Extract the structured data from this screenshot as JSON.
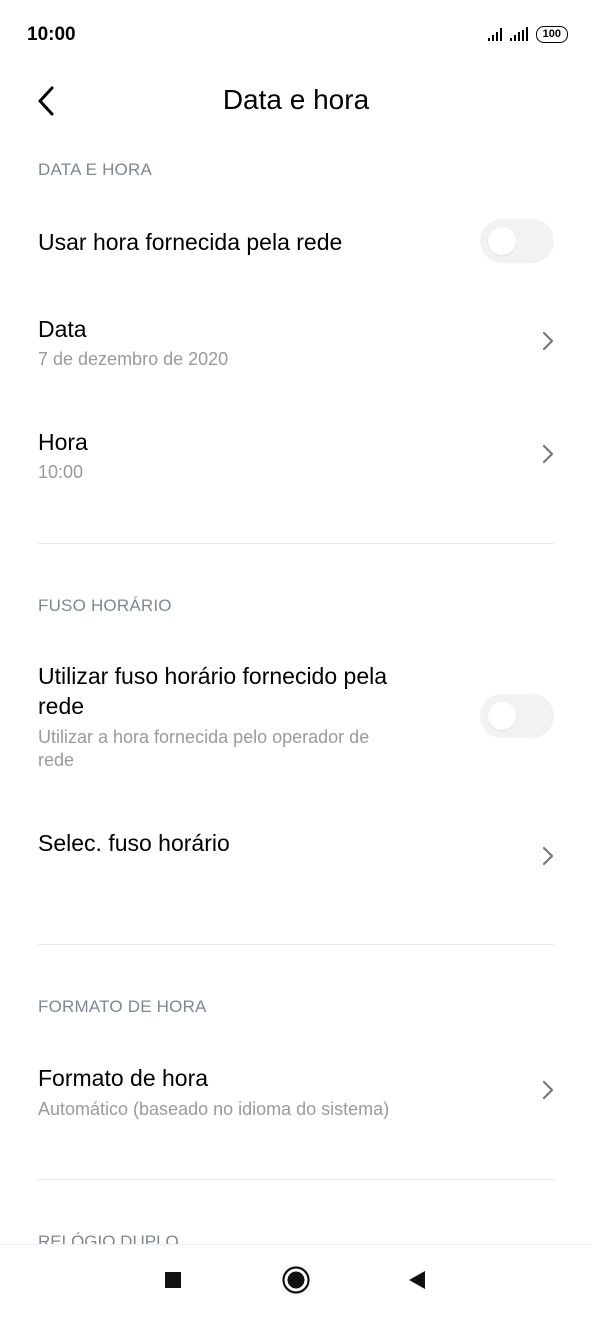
{
  "status_bar": {
    "time": "10:00",
    "battery": "100",
    "icons": [
      "signal-icon",
      "signal-icon",
      "battery-icon"
    ]
  },
  "header": {
    "title": "Data e hora",
    "back_icon": "back-arrow-icon"
  },
  "sections": {
    "date_time": {
      "label": "DATA E HORA",
      "network_time": {
        "title": "Usar hora fornecida pela rede",
        "enabled": false
      },
      "date": {
        "title": "Data",
        "value": "7 de dezembro de 2020"
      },
      "time": {
        "title": "Hora",
        "value": "10:00"
      }
    },
    "timezone": {
      "label": "FUSO HORÁRIO",
      "network_tz": {
        "title_line1": "Utilizar fuso horário fornecido pela",
        "title_line2": "rede",
        "subtitle_line1": "Utilizar a hora fornecida pelo operador de",
        "subtitle_line2": "rede",
        "enabled": false
      },
      "select_tz": {
        "title": "Selec. fuso horário"
      }
    },
    "time_format": {
      "label": "FORMATO DE HORA",
      "format": {
        "title": "Formato de hora",
        "value": "Automático (baseado no idioma do sistema)"
      }
    },
    "dual_clock": {
      "label": "RELÓGIO DUPLO"
    }
  },
  "nav_bar": {
    "icons": [
      "recents-square-icon",
      "home-circle-icon",
      "back-triangle-icon"
    ]
  },
  "colors": {
    "section_label": "#7d8796",
    "subtitle": "#9a9a9a",
    "toggle_off": "#f2f2f2",
    "divider": "#e6e6e6"
  }
}
